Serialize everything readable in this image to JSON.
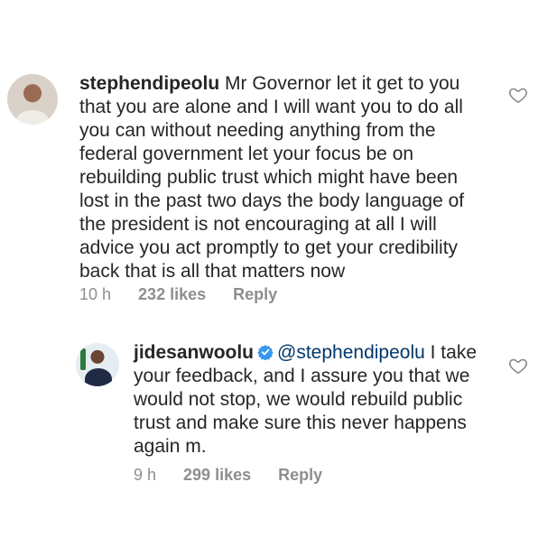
{
  "comments": [
    {
      "username": "stephendipeolu",
      "text": "Mr Governor let it get to you that you are alone and I will want you to do all you can without needing anything from the federal government let your focus be on rebuilding public trust which might have been lost in the past two days the body language of the president is not encouraging at all I will advice you act promptly to get your credibility back that is all that matters now",
      "time": "10 h",
      "likes": "232 likes",
      "reply_label": "Reply",
      "verified": false,
      "avatar_icon": "user-avatar",
      "like_icon": "heart-outline-icon"
    },
    {
      "username": "jidesanwoolu",
      "mention": "@stephendipeolu",
      "text": "I take your feedback, and I assure you that we would not stop, we would rebuild public trust and make sure this never happens again m.",
      "time": "9 h",
      "likes": "299 likes",
      "reply_label": "Reply",
      "verified": true,
      "avatar_icon": "user-avatar",
      "like_icon": "heart-outline-icon"
    }
  ],
  "colors": {
    "text": "#262626",
    "meta": "#8e8e8e",
    "mention": "#00376b",
    "verified": "#3897f0"
  }
}
